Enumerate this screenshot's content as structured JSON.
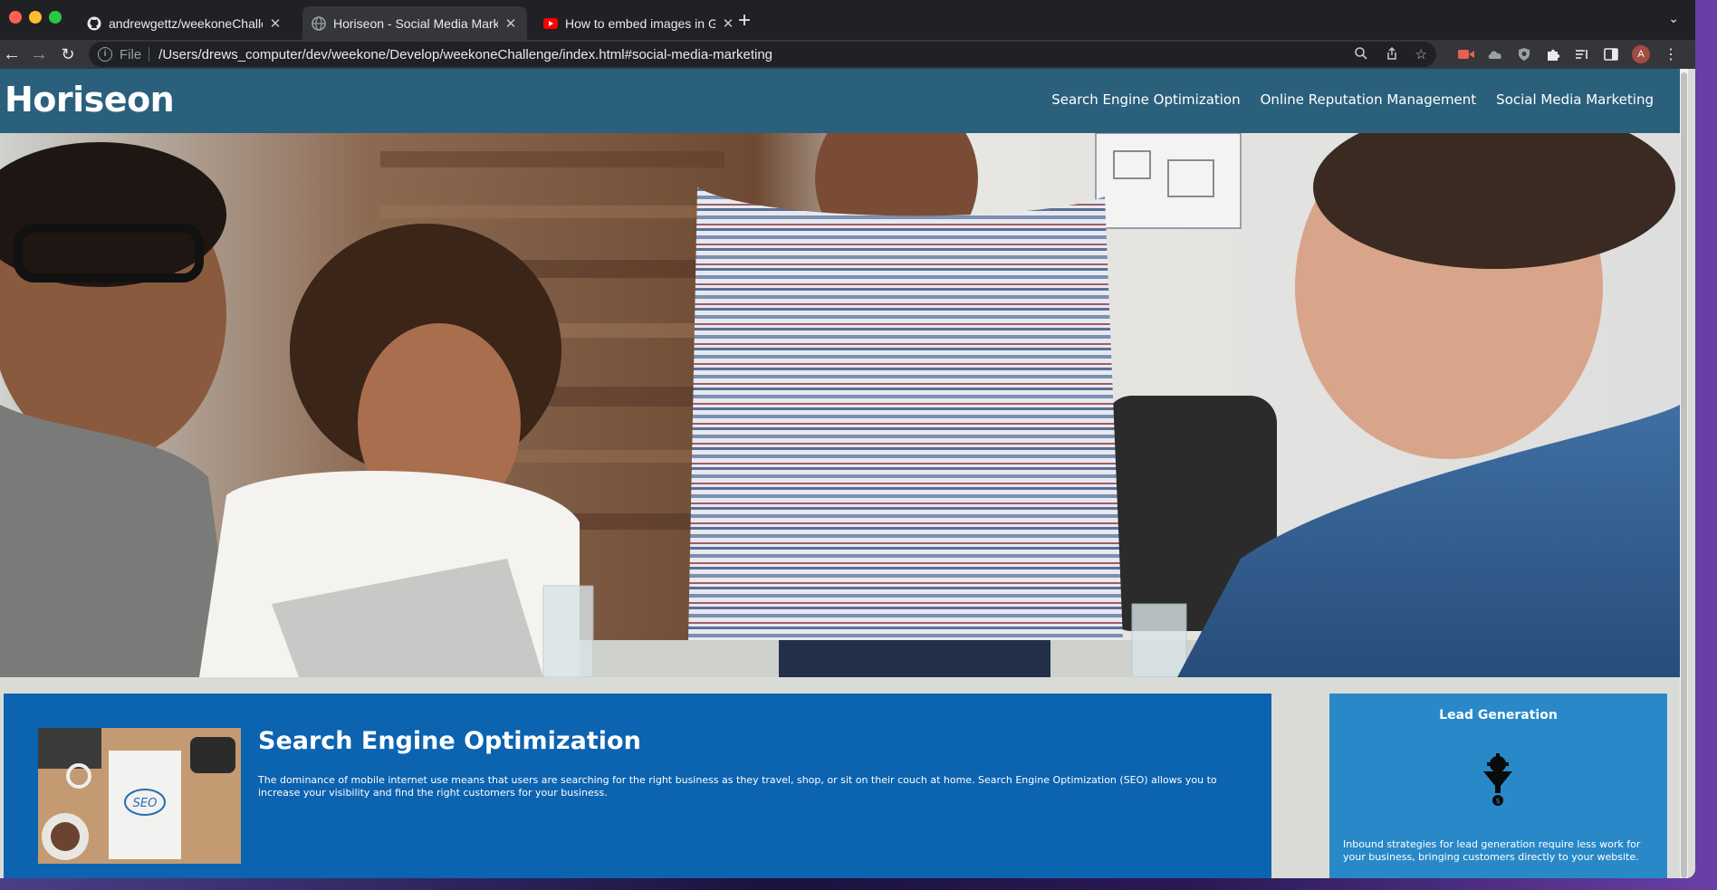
{
  "browser": {
    "tabs": [
      {
        "title": "andrewgettz/weekoneChalleng",
        "icon": "github-icon",
        "active": false
      },
      {
        "title": "Horiseon - Social Media Marke",
        "icon": "globe-icon",
        "active": true
      },
      {
        "title": "How to embed images in GitHu",
        "icon": "youtube-icon",
        "active": false
      }
    ],
    "file_label": "File",
    "url": "/Users/drews_computer/dev/weekone/Develop/weekoneChallenge/index.html#social-media-marketing",
    "avatar_letter": "A"
  },
  "site": {
    "logo": "Horiseon",
    "nav": [
      "Search Engine Optimization",
      "Online Reputation Management",
      "Social Media Marketing"
    ],
    "main_card": {
      "title": "Search Engine Optimization",
      "text": "The dominance of mobile internet use means that users are searching for the right business as they travel, shop, or sit on their couch at home. Search Engine Optimization (SEO) allows you to increase your visibility and find the right customers for your business.",
      "image_label": "SEO"
    },
    "side_card": {
      "title": "Lead Generation",
      "text": "Inbound strategies for lead generation require less work for your business, bringing customers directly to your website."
    }
  },
  "colors": {
    "header": "#2a607c",
    "main_card": "#0c63b0",
    "side_card": "#2989c8",
    "page_bg": "#d9dcd6"
  }
}
